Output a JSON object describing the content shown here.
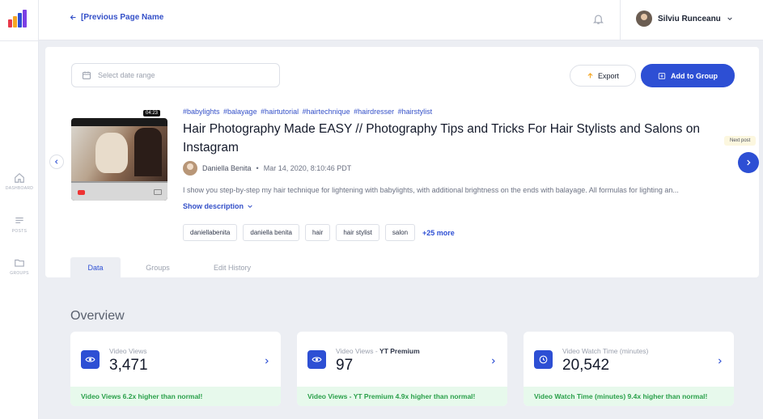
{
  "topbar": {
    "back_label": "[Previous Page Name",
    "user_name": "Silviu Runceanu"
  },
  "rail": {
    "items": [
      {
        "label": "DASHBOARD",
        "icon": "home-icon"
      },
      {
        "label": "POSTS",
        "icon": "posts-icon"
      },
      {
        "label": "GROUPS",
        "icon": "folder-icon"
      }
    ]
  },
  "toolbar": {
    "date_placeholder": "Select date range",
    "export_label": "Export",
    "add_to_group_label": "Add to Group"
  },
  "post": {
    "duration": "04:23",
    "hashtags": "#babylights #balayage #hairtutorial #hairtechnique #hairdresser #hairstylist",
    "title": "Hair Photography Made EASY // Photography Tips and Tricks For Hair Stylists and Salons on Instagram",
    "author": "Daniella Benita",
    "separator": "•",
    "date": "Mar 14, 2020, 8:10:46 PDT",
    "description": "I show you step-by-step my hair technique for lightening with babylights, with additional brightness on the ends with balayage. All formulas for lighting an...",
    "show_description_label": "Show description",
    "next_post_label": "Next post",
    "chips": [
      "daniellabenita",
      "daniella benita",
      "hair",
      "hair stylist",
      "salon"
    ],
    "more_chips": "+25 more"
  },
  "tabs": [
    {
      "label": "Data",
      "active": true
    },
    {
      "label": "Groups",
      "active": false
    },
    {
      "label": "Edit History",
      "active": false
    }
  ],
  "overview": {
    "title": "Overview",
    "metrics": [
      {
        "label": "Video Views",
        "label_suffix": "",
        "value": "3,471",
        "note": "Video Views 6.2x higher than normal!",
        "icon": "eye-icon"
      },
      {
        "label": "Video Views - ",
        "label_suffix": "YT Premium",
        "value": "97",
        "note": "Video Views - YT Premium 4.9x higher than normal!",
        "icon": "eye-icon"
      },
      {
        "label": "Video Watch Time (minutes)",
        "label_suffix": "",
        "value": "20,542",
        "note": "Video Watch Time (minutes) 9.4x higher than normal!",
        "icon": "clock-icon"
      }
    ]
  },
  "colors": {
    "accent": "#2d4fd4",
    "success_bg": "#e7f9ec",
    "success_text": "#2aa04a"
  }
}
